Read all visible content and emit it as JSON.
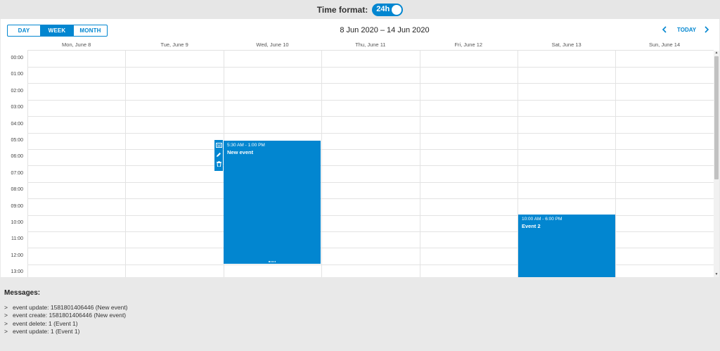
{
  "time_format": {
    "label": "Time format:",
    "value": "24h",
    "enabled": true
  },
  "toolbar": {
    "views": [
      "DAY",
      "WEEK",
      "MONTH"
    ],
    "active_view": "WEEK",
    "date_range": "8 Jun 2020 – 14 Jun 2020",
    "today_label": "TODAY",
    "prev_icon": "chevron-left-icon",
    "next_icon": "chevron-right-icon"
  },
  "days": [
    "Mon, June 8",
    "Tue, June 9",
    "Wed, June 10",
    "Thu, June 11",
    "Fri, June 12",
    "Sat, June 13",
    "Sun, June 14"
  ],
  "hours": [
    "00:00",
    "01:00",
    "02:00",
    "03:00",
    "04:00",
    "05:00",
    "06:00",
    "07:00",
    "08:00",
    "09:00",
    "10:00",
    "11:00",
    "12:00",
    "13:00"
  ],
  "events": [
    {
      "time": "5:30 AM - 1:00 PM",
      "title": "New event"
    },
    {
      "time": "10:00 AM - 6:00 PM",
      "title": "Event 2"
    }
  ],
  "event_tools": [
    "keyboard-icon",
    "pencil-icon",
    "trash-icon"
  ],
  "messages": {
    "title": "Messages:",
    "items": [
      "event update: 1581801406446 (New event)",
      "event create: 1581801406446 (New event)",
      "event delete: 1 (Event 1)",
      "event update: 1 (Event 1)"
    ]
  },
  "colors": {
    "accent": "#0286d0",
    "grid": "#e3e3e3",
    "background": "#e9e9e9"
  }
}
